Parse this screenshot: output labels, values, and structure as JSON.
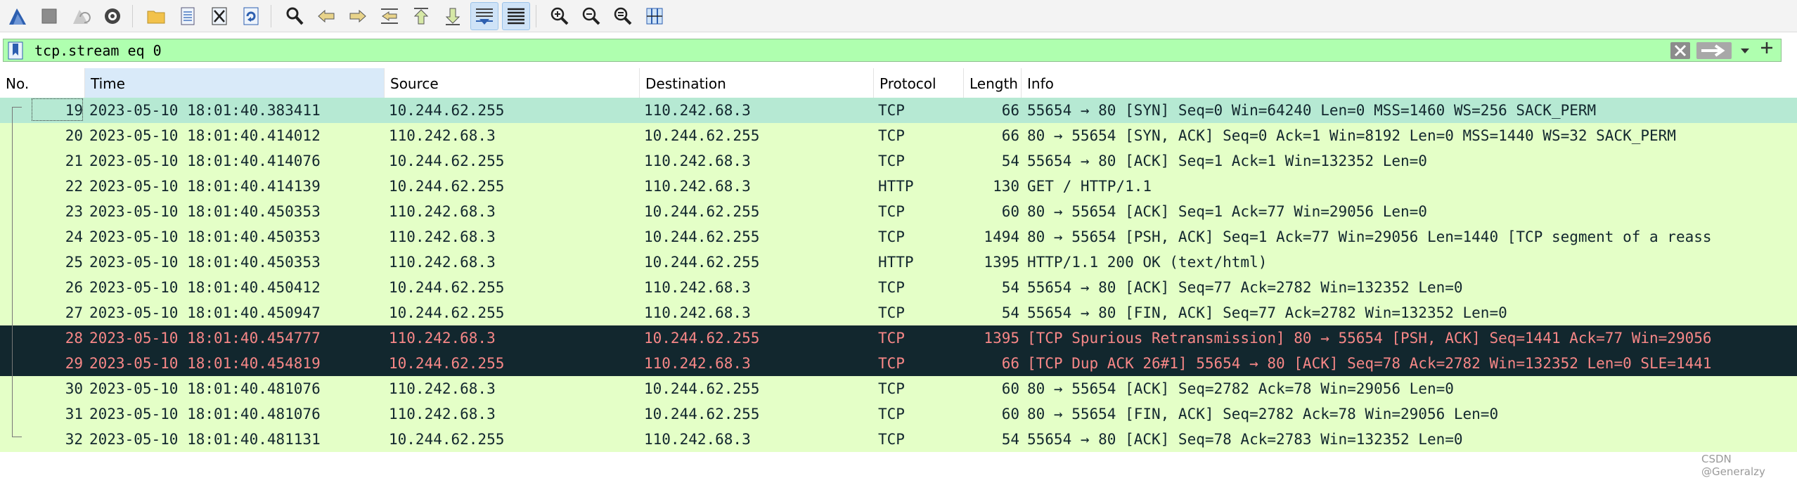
{
  "toolbar": {
    "buttons": [
      {
        "name": "start-capture-icon",
        "active": false
      },
      {
        "name": "stop-capture-icon",
        "active": false
      },
      {
        "name": "restart-capture-icon",
        "active": false
      },
      {
        "name": "capture-options-icon",
        "active": false
      },
      {
        "name": "open-file-icon",
        "active": false
      },
      {
        "name": "save-file-icon",
        "active": false
      },
      {
        "name": "close-file-icon",
        "active": false
      },
      {
        "name": "reload-file-icon",
        "active": false
      },
      {
        "name": "find-packet-icon",
        "active": false
      },
      {
        "name": "go-back-icon",
        "active": false
      },
      {
        "name": "go-forward-icon",
        "active": false
      },
      {
        "name": "go-to-packet-icon",
        "active": false
      },
      {
        "name": "go-first-packet-icon",
        "active": false
      },
      {
        "name": "go-last-packet-icon",
        "active": false
      },
      {
        "name": "auto-scroll-icon",
        "active": true
      },
      {
        "name": "colorize-icon",
        "active": true
      },
      {
        "name": "zoom-in-icon",
        "active": false
      },
      {
        "name": "zoom-out-icon",
        "active": false
      },
      {
        "name": "zoom-normal-icon",
        "active": false
      },
      {
        "name": "resize-columns-icon",
        "active": false
      }
    ]
  },
  "filter": {
    "value": "tcp.stream eq 0",
    "background": "#afffaf"
  },
  "columns": [
    "No.",
    "Time",
    "Source",
    "Destination",
    "Protocol",
    "Length",
    "Info"
  ],
  "colors": {
    "row_green": "#e4ffc7",
    "row_selected": "#b6e9d3",
    "row_dark": "#12272e",
    "dark_text": "#f78787",
    "normal_text": "#12272e"
  },
  "rows": [
    {
      "no": "19",
      "time": "2023-05-10 18:01:40.383411",
      "src": "10.244.62.255",
      "dst": "110.242.68.3",
      "proto": "TCP",
      "len": "66",
      "info": "55654 → 80 [SYN] Seq=0 Win=64240 Len=0 MSS=1460 WS=256 SACK_PERM",
      "style": "selected"
    },
    {
      "no": "20",
      "time": "2023-05-10 18:01:40.414012",
      "src": "110.242.68.3",
      "dst": "10.244.62.255",
      "proto": "TCP",
      "len": "66",
      "info": "80 → 55654 [SYN, ACK] Seq=0 Ack=1 Win=8192 Len=0 MSS=1440 WS=32 SACK_PERM",
      "style": "green"
    },
    {
      "no": "21",
      "time": "2023-05-10 18:01:40.414076",
      "src": "10.244.62.255",
      "dst": "110.242.68.3",
      "proto": "TCP",
      "len": "54",
      "info": "55654 → 80 [ACK] Seq=1 Ack=1 Win=132352 Len=0",
      "style": "green"
    },
    {
      "no": "22",
      "time": "2023-05-10 18:01:40.414139",
      "src": "10.244.62.255",
      "dst": "110.242.68.3",
      "proto": "HTTP",
      "len": "130",
      "info": "GET / HTTP/1.1",
      "style": "green"
    },
    {
      "no": "23",
      "time": "2023-05-10 18:01:40.450353",
      "src": "110.242.68.3",
      "dst": "10.244.62.255",
      "proto": "TCP",
      "len": "60",
      "info": "80 → 55654 [ACK] Seq=1 Ack=77 Win=29056 Len=0",
      "style": "green"
    },
    {
      "no": "24",
      "time": "2023-05-10 18:01:40.450353",
      "src": "110.242.68.3",
      "dst": "10.244.62.255",
      "proto": "TCP",
      "len": "1494",
      "info": "80 → 55654 [PSH, ACK] Seq=1 Ack=77 Win=29056 Len=1440 [TCP segment of a reass",
      "style": "green"
    },
    {
      "no": "25",
      "time": "2023-05-10 18:01:40.450353",
      "src": "110.242.68.3",
      "dst": "10.244.62.255",
      "proto": "HTTP",
      "len": "1395",
      "info": "HTTP/1.1 200 OK  (text/html)",
      "style": "green"
    },
    {
      "no": "26",
      "time": "2023-05-10 18:01:40.450412",
      "src": "10.244.62.255",
      "dst": "110.242.68.3",
      "proto": "TCP",
      "len": "54",
      "info": "55654 → 80 [ACK] Seq=77 Ack=2782 Win=132352 Len=0",
      "style": "green"
    },
    {
      "no": "27",
      "time": "2023-05-10 18:01:40.450947",
      "src": "10.244.62.255",
      "dst": "110.242.68.3",
      "proto": "TCP",
      "len": "54",
      "info": "55654 → 80 [FIN, ACK] Seq=77 Ack=2782 Win=132352 Len=0",
      "style": "green"
    },
    {
      "no": "28",
      "time": "2023-05-10 18:01:40.454777",
      "src": "110.242.68.3",
      "dst": "10.244.62.255",
      "proto": "TCP",
      "len": "1395",
      "info": "[TCP Spurious Retransmission] 80 → 55654 [PSH, ACK] Seq=1441 Ack=77 Win=29056",
      "style": "dark"
    },
    {
      "no": "29",
      "time": "2023-05-10 18:01:40.454819",
      "src": "10.244.62.255",
      "dst": "110.242.68.3",
      "proto": "TCP",
      "len": "66",
      "info": "[TCP Dup ACK 26#1] 55654 → 80 [ACK] Seq=78 Ack=2782 Win=132352 Len=0 SLE=1441",
      "style": "dark"
    },
    {
      "no": "30",
      "time": "2023-05-10 18:01:40.481076",
      "src": "110.242.68.3",
      "dst": "10.244.62.255",
      "proto": "TCP",
      "len": "60",
      "info": "80 → 55654 [ACK] Seq=2782 Ack=78 Win=29056 Len=0",
      "style": "green"
    },
    {
      "no": "31",
      "time": "2023-05-10 18:01:40.481076",
      "src": "110.242.68.3",
      "dst": "10.244.62.255",
      "proto": "TCP",
      "len": "60",
      "info": "80 → 55654 [FIN, ACK] Seq=2782 Ack=78 Win=29056 Len=0",
      "style": "green"
    },
    {
      "no": "32",
      "time": "2023-05-10 18:01:40.481131",
      "src": "10.244.62.255",
      "dst": "110.242.68.3",
      "proto": "TCP",
      "len": "54",
      "info": "55654 → 80 [ACK] Seq=78 Ack=2783 Win=132352 Len=0",
      "style": "green"
    }
  ],
  "watermark": "CSDN @Generalzy"
}
